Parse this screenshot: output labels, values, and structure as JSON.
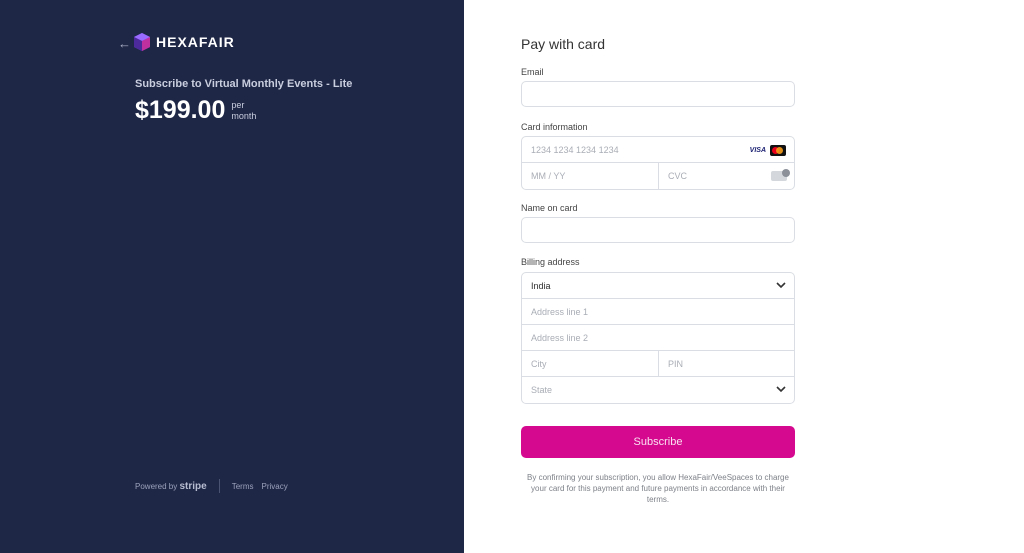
{
  "brand": {
    "name": "HEXAFAIR"
  },
  "product": {
    "description": "Subscribe to Virtual Monthly Events - Lite",
    "price": "$199.00",
    "period_line1": "per",
    "period_line2": "month"
  },
  "footer": {
    "powered_by": "Powered by",
    "stripe": "stripe",
    "terms": "Terms",
    "privacy": "Privacy"
  },
  "form": {
    "title": "Pay with card",
    "email_label": "Email",
    "card_label": "Card information",
    "card_number_placeholder": "1234 1234 1234 1234",
    "card_brand_visa": "VISA",
    "expiry_placeholder": "MM / YY",
    "cvc_placeholder": "CVC",
    "name_label": "Name on card",
    "billing_label": "Billing address",
    "country_value": "India",
    "address1_placeholder": "Address line 1",
    "address2_placeholder": "Address line 2",
    "city_placeholder": "City",
    "pin_placeholder": "PIN",
    "state_placeholder": "State",
    "subscribe_label": "Subscribe",
    "terms_text": "By confirming your subscription, you allow HexaFair/VeeSpaces to charge your card for this payment and future payments in accordance with their terms."
  },
  "colors": {
    "left_panel": "#1f2747",
    "accent": "#d5098f"
  },
  "icons": {
    "back": "arrow-left-icon",
    "logo": "hexafair-cube-icon",
    "chevron": "chevron-down-icon",
    "card": "mastercard-icon",
    "cvc": "cvc-card-icon"
  }
}
